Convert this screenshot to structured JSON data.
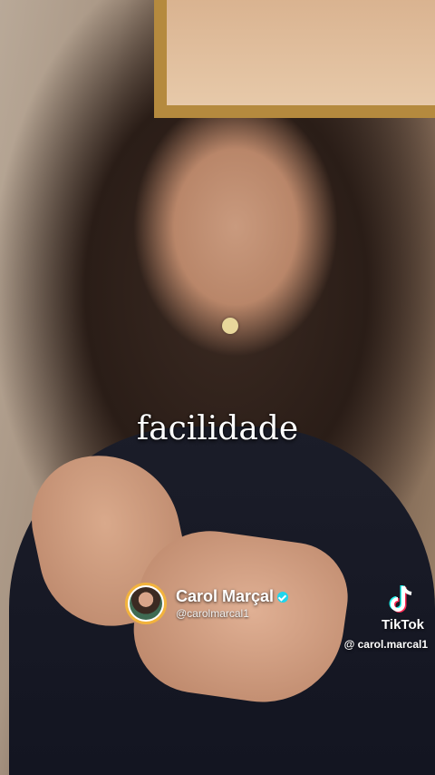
{
  "video": {
    "caption": "facilidade"
  },
  "creator": {
    "name": "Carol Marçal",
    "handle": "@carolmarcal1",
    "verified_icon": "verified-badge-icon",
    "accent_color": "#f2b33d"
  },
  "watermark": {
    "brand": "TikTok",
    "handle": "@ carol.marcal1",
    "icon": "tiktok-logo-icon"
  }
}
